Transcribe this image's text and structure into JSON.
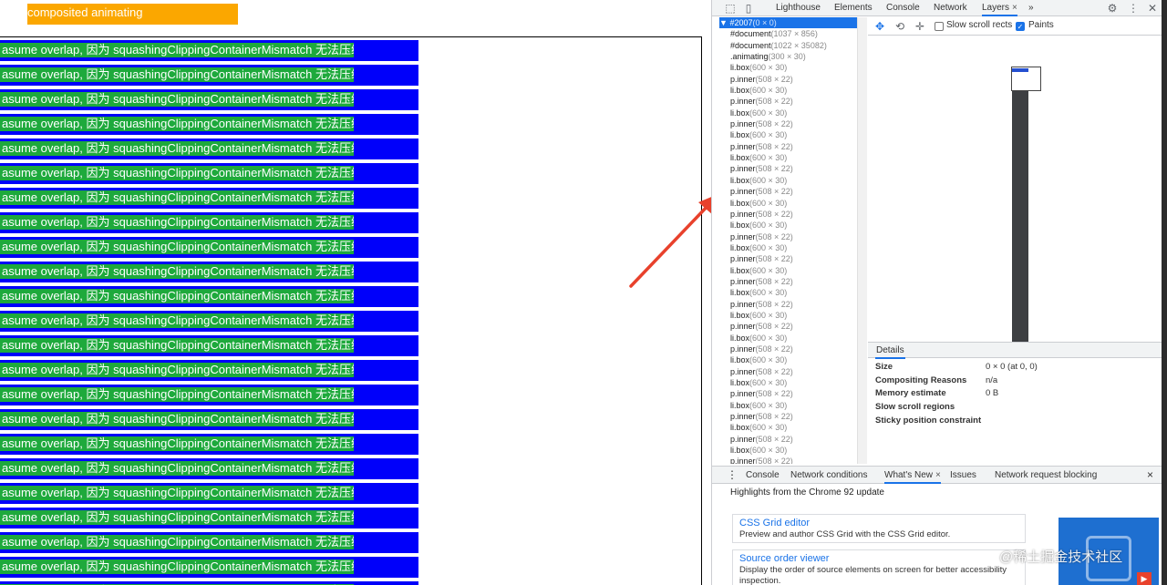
{
  "page": {
    "animating_label": "composited animating",
    "row_text": "asume overlap, 因为 squashingClippingContainerMismatch 无法压缩",
    "row_count": 23,
    "colors": {
      "box": "#0000fa",
      "inner": "#1ea93c",
      "animating": "#fba700"
    }
  },
  "devtools": {
    "tabs": [
      {
        "label": "Lighthouse"
      },
      {
        "label": "Elements"
      },
      {
        "label": "Console"
      },
      {
        "label": "Network"
      },
      {
        "label": "Layers",
        "active": true,
        "close": "×"
      }
    ],
    "more": "»",
    "layers_tree": {
      "root": {
        "name": "#2007",
        "dims": "(0 × 0)",
        "expander": "▼"
      },
      "items": [
        {
          "name": "#document",
          "dims": "(1037 × 856)"
        },
        {
          "name": "#document",
          "dims": "(1022 × 35082)"
        },
        {
          "name": ".animating",
          "dims": "(300 × 30)"
        },
        {
          "name": "li.box",
          "dims": "(600 × 30)"
        },
        {
          "name": "p.inner",
          "dims": "(508 × 22)"
        },
        {
          "name": "li.box",
          "dims": "(600 × 30)"
        },
        {
          "name": "p.inner",
          "dims": "(508 × 22)"
        },
        {
          "name": "li.box",
          "dims": "(600 × 30)"
        },
        {
          "name": "p.inner",
          "dims": "(508 × 22)"
        },
        {
          "name": "li.box",
          "dims": "(600 × 30)"
        },
        {
          "name": "p.inner",
          "dims": "(508 × 22)"
        },
        {
          "name": "li.box",
          "dims": "(600 × 30)"
        },
        {
          "name": "p.inner",
          "dims": "(508 × 22)"
        },
        {
          "name": "li.box",
          "dims": "(600 × 30)"
        },
        {
          "name": "p.inner",
          "dims": "(508 × 22)"
        },
        {
          "name": "li.box",
          "dims": "(600 × 30)"
        },
        {
          "name": "p.inner",
          "dims": "(508 × 22)"
        },
        {
          "name": "li.box",
          "dims": "(600 × 30)"
        },
        {
          "name": "p.inner",
          "dims": "(508 × 22)"
        },
        {
          "name": "li.box",
          "dims": "(600 × 30)"
        },
        {
          "name": "p.inner",
          "dims": "(508 × 22)"
        },
        {
          "name": "li.box",
          "dims": "(600 × 30)"
        },
        {
          "name": "p.inner",
          "dims": "(508 × 22)"
        },
        {
          "name": "li.box",
          "dims": "(600 × 30)"
        },
        {
          "name": "p.inner",
          "dims": "(508 × 22)"
        },
        {
          "name": "li.box",
          "dims": "(600 × 30)"
        },
        {
          "name": "p.inner",
          "dims": "(508 × 22)"
        },
        {
          "name": "li.box",
          "dims": "(600 × 30)"
        },
        {
          "name": "p.inner",
          "dims": "(508 × 22)"
        },
        {
          "name": "li.box",
          "dims": "(600 × 30)"
        },
        {
          "name": "p.inner",
          "dims": "(508 × 22)"
        },
        {
          "name": "li.box",
          "dims": "(600 × 30)"
        },
        {
          "name": "p.inner",
          "dims": "(508 × 22)"
        },
        {
          "name": "li.box",
          "dims": "(600 × 30)"
        },
        {
          "name": "p.inner",
          "dims": "(508 × 22)"
        },
        {
          "name": "li.box",
          "dims": "(600 × 30)"
        },
        {
          "name": "p.inner",
          "dims": "(508 × 22)"
        },
        {
          "name": "li.box",
          "dims": "(600 × 30)"
        },
        {
          "name": "p.inner",
          "dims": "(508 × 22)"
        }
      ]
    },
    "toolbar": {
      "slow_scroll_rects": {
        "label": "Slow scroll rects",
        "checked": false
      },
      "paints": {
        "label": "Paints",
        "checked": true
      }
    },
    "details": {
      "tab_label": "Details",
      "rows": [
        {
          "key": "Size",
          "value": "0 × 0 (at 0, 0)"
        },
        {
          "key": "Compositing Reasons",
          "value": "n/a"
        },
        {
          "key": "Memory estimate",
          "value": "0 B"
        },
        {
          "key": "Slow scroll regions",
          "value": ""
        },
        {
          "key": "Sticky position constraint",
          "value": ""
        }
      ]
    },
    "drawer": {
      "tabs": [
        {
          "label": "Console"
        },
        {
          "label": "Network conditions"
        },
        {
          "label": "What's New",
          "active": true,
          "close": "×"
        },
        {
          "label": "Issues"
        },
        {
          "label": "Network request blocking"
        }
      ],
      "close": "×",
      "highlights": "Highlights from the Chrome 92 update",
      "news": [
        {
          "title": "CSS Grid editor",
          "desc": "Preview and author CSS Grid with the CSS Grid editor."
        },
        {
          "title": "Source order viewer",
          "desc": "Display the order of source elements on screen for better accessibility inspection."
        }
      ]
    }
  },
  "watermark": "@稀土掘金技术社区"
}
